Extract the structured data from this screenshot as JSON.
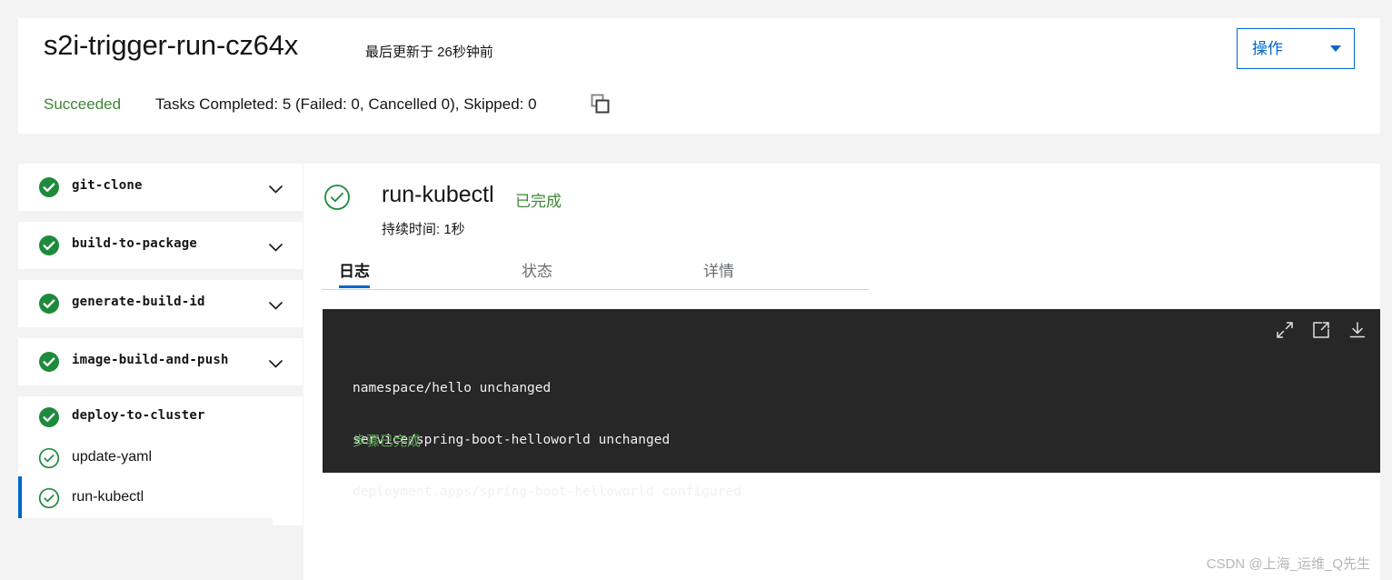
{
  "header": {
    "title": "s2i-trigger-run-cz64x",
    "updated": "最后更新于 26秒钟前",
    "actions_label": "操作",
    "status": "Succeeded",
    "tasks_summary": "Tasks Completed: 5 (Failed: 0, Cancelled 0), Skipped: 0",
    "copy_icon": "copy-icon",
    "caret_icon": "chevron-down-icon"
  },
  "sidebar": {
    "tasks": [
      {
        "label": "git-clone",
        "status": "succeeded",
        "expandable": true
      },
      {
        "label": "build-to-package",
        "status": "succeeded",
        "expandable": true
      },
      {
        "label": "generate-build-id",
        "status": "succeeded",
        "expandable": true
      },
      {
        "label": "image-build-and-push",
        "status": "succeeded",
        "expandable": true
      }
    ],
    "expanded_task": {
      "label": "deploy-to-cluster",
      "status": "succeeded",
      "steps": [
        {
          "label": "update-yaml",
          "status": "succeeded",
          "selected": false
        },
        {
          "label": "run-kubectl",
          "status": "succeeded",
          "selected": true
        }
      ]
    },
    "chevron_icon": "chevron-down-icon"
  },
  "main": {
    "step_title": "run-kubectl",
    "step_state": "已完成",
    "duration": "持续时间: 1秒",
    "tabs": [
      {
        "label": "日志",
        "active": true
      },
      {
        "label": "状态",
        "active": false
      },
      {
        "label": "详情",
        "active": false
      }
    ]
  },
  "log": {
    "lines": [
      "namespace/hello unchanged",
      "service/spring-boot-helloworld unchanged",
      "deployment.apps/spring-boot-helloworld configured"
    ],
    "done_text": "步骤已完成",
    "tools": [
      "expand-icon",
      "external-link-icon",
      "download-icon"
    ]
  },
  "watermark": "CSDN @上海_运维_Q先生",
  "colors": {
    "accent": "#0066cc",
    "success": "#3e8635",
    "log_bg": "#272727",
    "log_success": "#5ba352",
    "page_bg": "#f3f3f3"
  }
}
